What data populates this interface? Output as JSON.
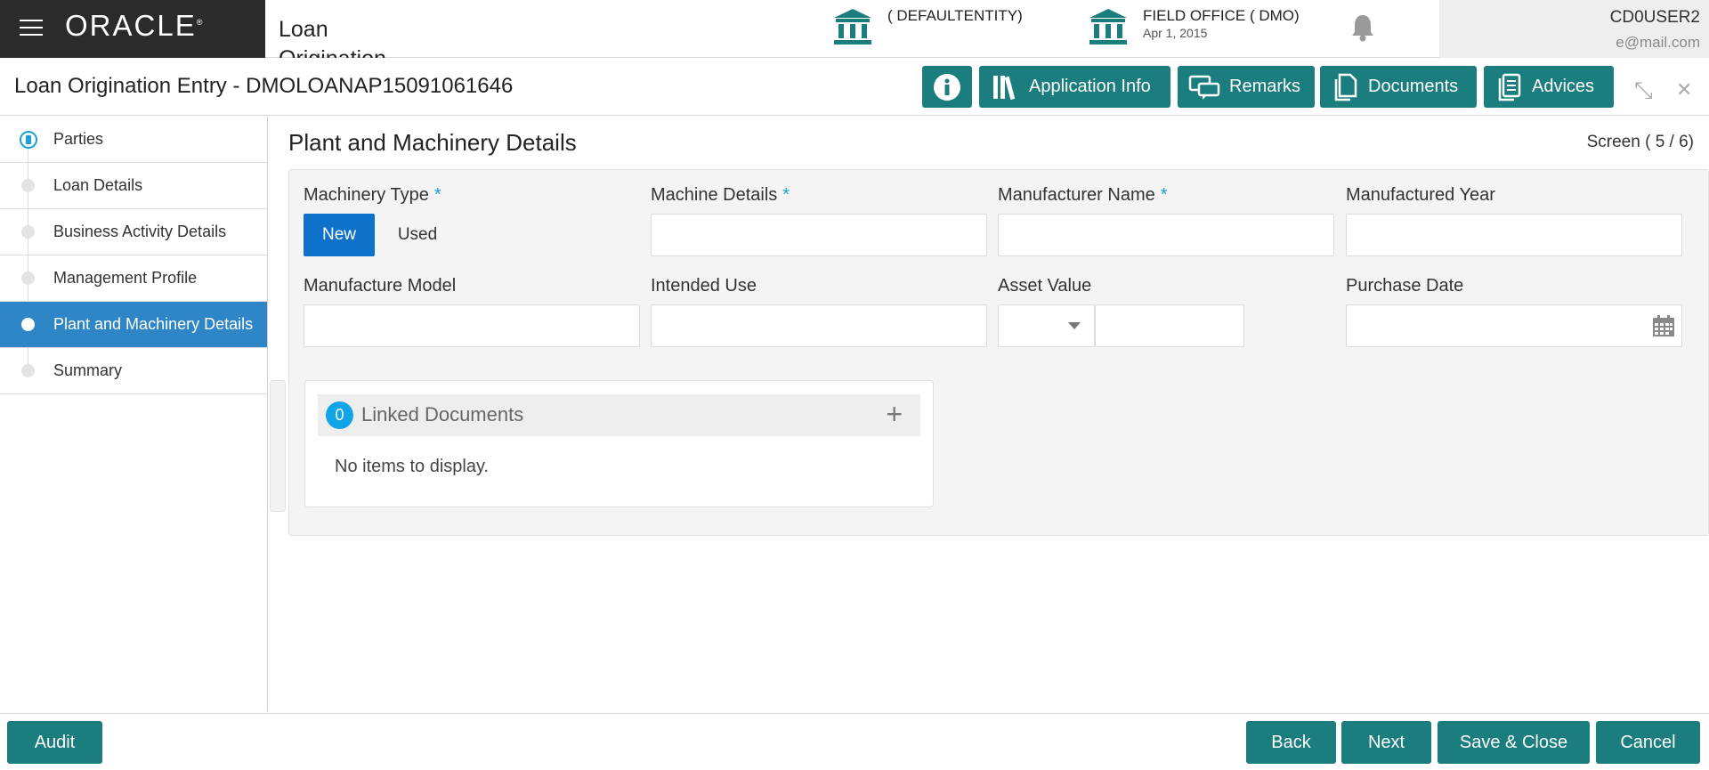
{
  "header": {
    "logo": "ORACLE",
    "logo_mark": "®",
    "app_name": "Loan Origination",
    "entity1": {
      "name": "( DEFAULTENTITY)",
      "icon": "bank-icon"
    },
    "entity2": {
      "name": "FIELD OFFICE  ( DMO)",
      "date": "Apr 1, 2015",
      "icon": "bank-icon"
    },
    "notification_icon": "bell-icon",
    "user": {
      "name": "CD0USER2",
      "email": "e@mail.com"
    }
  },
  "titlebar": {
    "title": "Loan Origination Entry - DMOLOANAP15091061646",
    "buttons": {
      "info_icon": "info-icon",
      "application_info": "Application Info",
      "remarks": "Remarks",
      "documents": "Documents",
      "advices": "Advices"
    },
    "minimize_glyph": "⤡",
    "close_glyph": "✕"
  },
  "sidebar": {
    "items": [
      {
        "label": "Parties",
        "state": "current-step"
      },
      {
        "label": "Loan Details",
        "state": "normal"
      },
      {
        "label": "Business Activity Details",
        "state": "normal"
      },
      {
        "label": "Management Profile",
        "state": "normal"
      },
      {
        "label": "Plant and Machinery Details",
        "state": "active"
      },
      {
        "label": "Summary",
        "state": "normal"
      }
    ]
  },
  "main": {
    "section_title": "Plant and Machinery Details",
    "screen": "Screen ( 5 / 6)",
    "required_mark": "*",
    "fields": {
      "machinery_type": {
        "label": "Machinery Type",
        "options": [
          "New",
          "Used"
        ],
        "selected": "New"
      },
      "machine_details": {
        "label": "Machine Details",
        "value": ""
      },
      "manufacturer_name": {
        "label": "Manufacturer Name",
        "value": ""
      },
      "manufactured_year": {
        "label": "Manufactured Year",
        "value": ""
      },
      "manufacture_model": {
        "label": "Manufacture Model",
        "value": ""
      },
      "intended_use": {
        "label": "Intended Use",
        "value": ""
      },
      "asset_value": {
        "label": "Asset Value",
        "currency": "",
        "amount": ""
      },
      "purchase_date": {
        "label": "Purchase Date",
        "value": "",
        "icon": "calendar-icon"
      }
    },
    "linked_documents": {
      "count": "0",
      "title": "Linked Documents",
      "add_glyph": "+",
      "empty_text": "No items to display."
    }
  },
  "footer": {
    "audit": "Audit",
    "back": "Back",
    "next": "Next",
    "save_close": "Save & Close",
    "cancel": "Cancel"
  },
  "colors": {
    "teal_button": "#1b7d7d",
    "active_nav": "#2f86c6",
    "selected_toggle": "#0f72ca",
    "badge": "#11a5e8",
    "brand_bg": "#2b2b2b"
  }
}
